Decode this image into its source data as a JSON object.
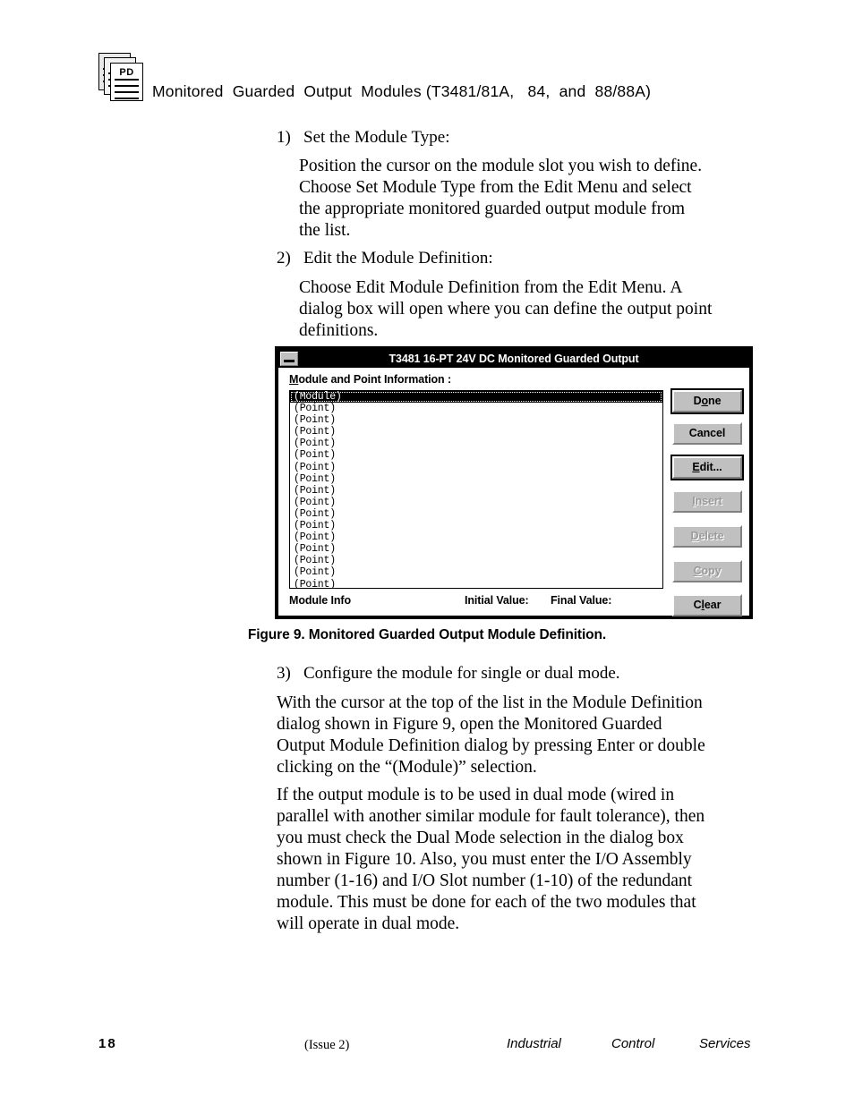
{
  "header": {
    "icon_name": "document-stack-icon",
    "icon_label": "PD",
    "title": "Monitored  Guarded  Output  Modules (T3481/81A,   84,  and  88/88A)"
  },
  "steps": [
    {
      "number": "1)",
      "title": "Set the Module Type:",
      "body": [
        "Position the cursor on the module slot you wish to define.",
        "Choose Set Module Type from the Edit Menu and select",
        "the appropriate monitored guarded output module from",
        "the list."
      ]
    },
    {
      "number": "2)",
      "title": "Edit the Module Definition:",
      "body": [
        "Choose Edit Module Definition from the Edit Menu.  A",
        "dialog box will open where you can define the output point",
        "definitions."
      ]
    },
    {
      "number": "3)",
      "title": "Configure the module for single or dual mode.",
      "body": []
    }
  ],
  "paragraphs": {
    "after_figure": [
      "With the cursor at the top of the list in the Module Definition",
      "dialog shown in Figure 9, open the Monitored Guarded",
      "Output Module Definition dialog by pressing Enter or double",
      "clicking on the “(Module)” selection."
    ],
    "dual_mode": [
      "If the output module is to be used in dual mode (wired in",
      "parallel with another similar module for fault tolerance), then",
      "you must check the Dual Mode selection in the dialog box",
      "shown in Figure 10.  Also, you must enter the I/O Assembly",
      "number (1-16) and I/O Slot number (1-10) of the redundant",
      "module.  This must be done for each of the two modules that",
      "will operate in dual mode."
    ]
  },
  "dialog": {
    "title": "T3481 16-PT  24V DC Monitored Guarded Output",
    "minimize_icon": "minimize-icon",
    "group_label": "Module and Point Information :",
    "group_label_mnemonic": "M",
    "group_label_rest": "odule and Point Information :",
    "list_items": [
      "(Module)",
      "(Point)",
      "(Point)",
      "(Point)",
      "(Point)",
      "(Point)",
      "(Point)",
      "(Point)",
      "(Point)",
      "(Point)",
      "(Point)",
      "(Point)",
      "(Point)",
      "(Point)",
      "(Point)",
      "(Point)",
      "(Point)"
    ],
    "selected_index": 0,
    "buttons": [
      {
        "label": "Done",
        "mnemonic": "o",
        "pre": "D",
        "post": "ne",
        "state": "default"
      },
      {
        "label": "Cancel",
        "mnemonic": "",
        "pre": "Cancel",
        "post": "",
        "state": "enabled"
      },
      {
        "label": "Edit...",
        "mnemonic": "E",
        "pre": "",
        "post": "dit...",
        "state": "enabled"
      },
      {
        "label": "Insert",
        "mnemonic": "I",
        "pre": "",
        "post": "nsert",
        "state": "disabled"
      },
      {
        "label": "Delete",
        "mnemonic": "D",
        "pre": "",
        "post": "elete",
        "state": "disabled"
      },
      {
        "label": "Copy",
        "mnemonic": "C",
        "pre": "",
        "post": "opy",
        "state": "disabled"
      },
      {
        "label": "Clear",
        "mnemonic": "l",
        "pre": "C",
        "post": "ear",
        "state": "enabled"
      }
    ],
    "status": {
      "module_info": "Module Info",
      "initial_value": "Initial Value:",
      "final_value": "Final Value:"
    }
  },
  "figure_caption": "Figure 9.  Monitored Guarded Output Module Definition.",
  "footer": {
    "page_number": "18",
    "issue": "(Issue 2)",
    "brand": [
      "Industrial",
      "Control",
      "Services"
    ]
  },
  "colors": {
    "page_bg": "#ffffff",
    "text": "#000000",
    "dialog_face": "#c0c0c0",
    "dialog_shadow": "#808080",
    "dialog_highlight": "#ffffff",
    "disabled_text": "#9a9a9a",
    "selection_bg": "#000000",
    "selection_fg": "#ffffff"
  }
}
